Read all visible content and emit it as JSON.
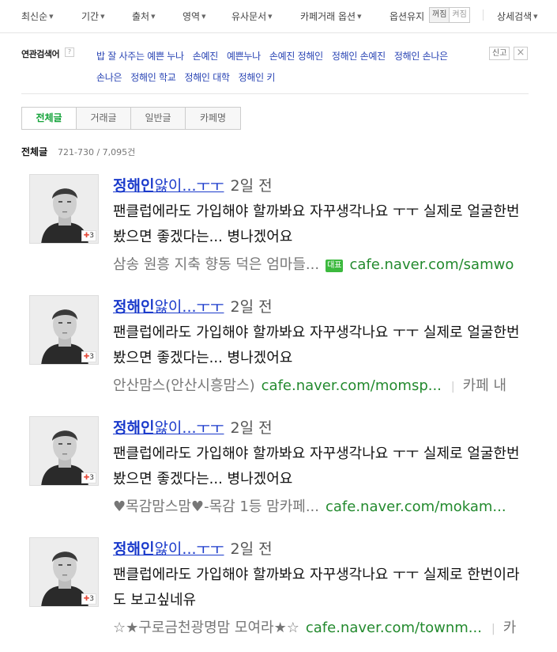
{
  "filters": {
    "sort": "최신순",
    "period": "기간",
    "source": "출처",
    "area": "영역",
    "similar": "유사문서",
    "cafe_trade": "카페거래 옵션",
    "keep_option": "옵션유지",
    "toggle_off": "꺼짐",
    "toggle_on": "켜짐",
    "detail_search": "상세검색"
  },
  "related": {
    "label": "연관검색어",
    "help": "?",
    "links": [
      "밥 잘 사주는 예쁜 누나",
      "손예진",
      "예쁜누나",
      "손예진 정해인",
      "정해인 손예진",
      "정해인 손나은",
      "손나은",
      "정해인 학교",
      "정해인 대학",
      "정해인 키"
    ],
    "report": "신고",
    "close": "×"
  },
  "tabs": [
    "전체글",
    "거래글",
    "일반글",
    "카페명"
  ],
  "section": {
    "title": "전체글",
    "range": "721-730 / 7,095건"
  },
  "results": [
    {
      "title_hl": "정해인",
      "title_rest": "앓이...ㅜㅜ",
      "date": "2일 전",
      "body": "팬클럽에라도 가입해야 할까봐요 자꾸생각나요 ㅜㅜ 실제로 얼굴한번 봤으면 좋겠다는... 병나겠어요",
      "cafe": "삼송 원흥 지축 향동 덕은 엄마들...",
      "badge": "대표",
      "url": "cafe.naver.com/samwo",
      "in_cafe": "",
      "likes": "3"
    },
    {
      "title_hl": "정해인",
      "title_rest": "앓이...ㅜㅜ",
      "date": "2일 전",
      "body": "팬클럽에라도 가입해야 할까봐요 자꾸생각나요 ㅜㅜ 실제로 얼굴한번 봤으면 좋겠다는... 병나겠어요",
      "cafe": "안산맘스(안산시흥맘스)",
      "badge": "",
      "url": "cafe.naver.com/momsp...",
      "in_cafe": "카페 내",
      "likes": "3"
    },
    {
      "title_hl": "정해인",
      "title_rest": "앓이...ㅜㅜ",
      "date": "2일 전",
      "body": "팬클럽에라도 가입해야 할까봐요 자꾸생각나요 ㅜㅜ 실제로 얼굴한번 봤으면 좋겠다는... 병나겠어요",
      "cafe": "♥목감맘스맘♥-목감 1등 맘카페...",
      "badge": "",
      "url": "cafe.naver.com/mokam...",
      "in_cafe": "",
      "likes": "3"
    },
    {
      "title_hl": "정해인",
      "title_rest": "앓이...ㅜㅜ",
      "date": "2일 전",
      "body": "팬클럽에라도 가입해야 할까봐요 자꾸생각나요 ㅜㅜ 실제로 한번이라도 보고싶네유",
      "cafe": "☆★구로금천광명맘 모여라★☆",
      "badge": "",
      "url": "cafe.naver.com/townm...",
      "in_cafe": "카",
      "likes": "3"
    }
  ],
  "colors": {
    "link": "#1a3acb",
    "related_link": "#2a45b4",
    "url": "#238a2e",
    "active_tab": "#13a339",
    "badge": "#3cb93e"
  }
}
